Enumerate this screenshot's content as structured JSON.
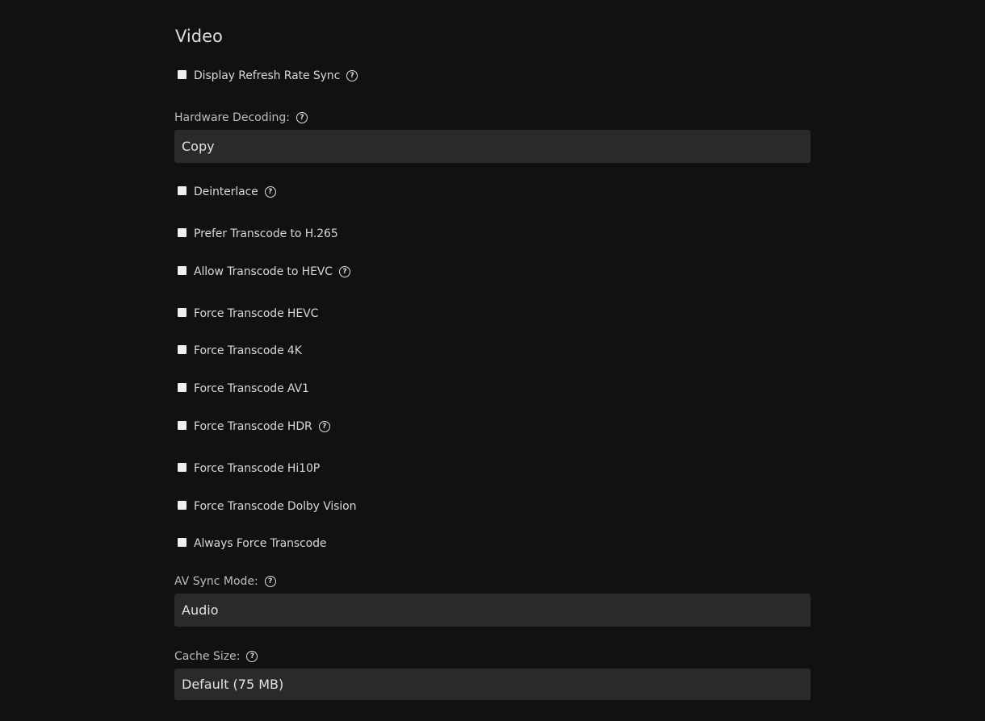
{
  "section": {
    "title": "Video"
  },
  "options": {
    "display_refresh_rate_sync": {
      "label": "Display Refresh Rate Sync",
      "checked": false
    },
    "deinterlace": {
      "label": "Deinterlace",
      "checked": false
    },
    "prefer_transcode_h265": {
      "label": "Prefer Transcode to H.265",
      "checked": false
    },
    "allow_transcode_hevc": {
      "label": "Allow Transcode to HEVC",
      "checked": false
    },
    "force_transcode_hevc": {
      "label": "Force Transcode HEVC",
      "checked": false
    },
    "force_transcode_4k": {
      "label": "Force Transcode 4K",
      "checked": false
    },
    "force_transcode_av1": {
      "label": "Force Transcode AV1",
      "checked": false
    },
    "force_transcode_hdr": {
      "label": "Force Transcode HDR",
      "checked": false
    },
    "force_transcode_hi10p": {
      "label": "Force Transcode Hi10P",
      "checked": false
    },
    "force_transcode_dolby_vision": {
      "label": "Force Transcode Dolby Vision",
      "checked": false
    },
    "always_force_transcode": {
      "label": "Always Force Transcode",
      "checked": false
    }
  },
  "hardware_decoding": {
    "label": "Hardware Decoding:",
    "value": "Copy"
  },
  "av_sync_mode": {
    "label": "AV Sync Mode:",
    "value": "Audio"
  },
  "cache_size": {
    "label": "Cache Size:",
    "value": "Default (75 MB)"
  },
  "icons": {
    "help": "?"
  },
  "colors": {
    "background": "#111111",
    "select_background": "#2a2a2a",
    "text": "#d8d8d8",
    "checkbox": "#f0f0f0"
  }
}
